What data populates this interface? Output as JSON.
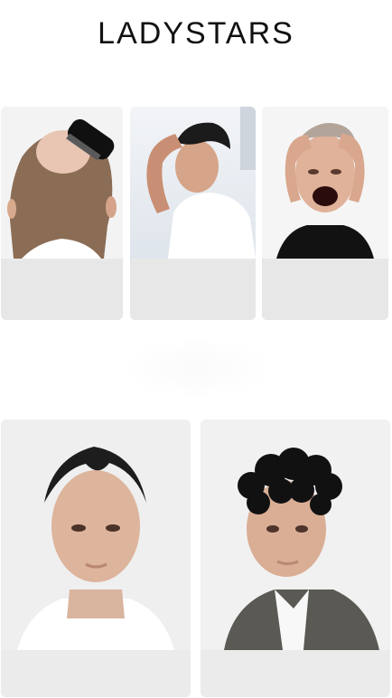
{
  "brand": {
    "logo_text": "LADYSTARS"
  },
  "colors": {
    "page_bg": "#ffffff",
    "card_bg": "#e9e9e9",
    "text": "#111111"
  },
  "top_row": {
    "images": [
      {
        "icon": "balding-scalp-with-comb-image"
      },
      {
        "icon": "man-touching-head-sunlight-image"
      },
      {
        "icon": "stressed-man-holding-head-image"
      }
    ]
  },
  "bottom_row": {
    "images": [
      {
        "icon": "man-receding-hairline-portrait-image"
      },
      {
        "icon": "man-curly-hair-portrait-image"
      }
    ]
  }
}
